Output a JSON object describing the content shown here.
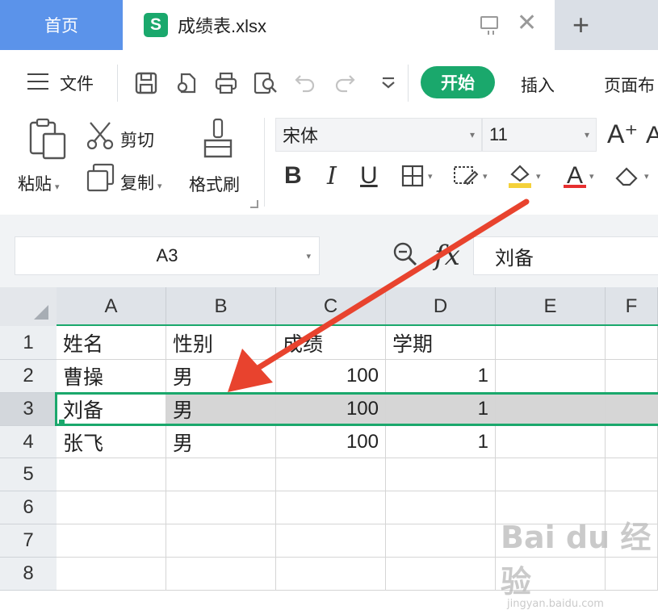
{
  "tabs": {
    "home_label": "首页",
    "file_icon_letter": "S",
    "file_name": "成绩表.xlsx",
    "close_glyph": "✕",
    "add_glyph": "+"
  },
  "menu": {
    "file_label": "文件",
    "start_label": "开始",
    "insert_label": "插入",
    "page_layout_label": "页面布"
  },
  "ribbon": {
    "paste_label": "粘贴",
    "cut_label": "剪切",
    "copy_label": "复制",
    "format_painter_label": "格式刷",
    "font_name": "宋体",
    "font_size": "11",
    "bold": "B",
    "italic": "I",
    "underline": "U",
    "font_color_glyph": "A",
    "grow_font_glyph": "A⁺",
    "shrink_font_glyph": "A"
  },
  "formula_bar": {
    "cell_ref": "A3",
    "fx_label": "fx",
    "content": "刘备"
  },
  "grid": {
    "columns": [
      "A",
      "B",
      "C",
      "D",
      "E",
      "F"
    ],
    "rows": [
      "1",
      "2",
      "3",
      "4",
      "5",
      "6",
      "7",
      "8"
    ],
    "cells": [
      [
        "姓名",
        "性别",
        "成绩",
        "学期",
        ""
      ],
      [
        "曹操",
        "男",
        "100",
        "1",
        ""
      ],
      [
        "刘备",
        "男",
        "100",
        "1",
        ""
      ],
      [
        "张飞",
        "男",
        "100",
        "1",
        ""
      ],
      [
        "",
        "",
        "",
        "",
        ""
      ],
      [
        "",
        "",
        "",
        "",
        ""
      ],
      [
        "",
        "",
        "",
        "",
        ""
      ],
      [
        "",
        "",
        "",
        "",
        ""
      ]
    ],
    "selected_row": 3
  },
  "watermark": {
    "main": "Bai du 经验",
    "sub": "jingyan.baidu.com"
  },
  "colors": {
    "accent_green": "#1aa86c",
    "home_tab_blue": "#5b93ea",
    "annotation_red": "#e8432e"
  }
}
